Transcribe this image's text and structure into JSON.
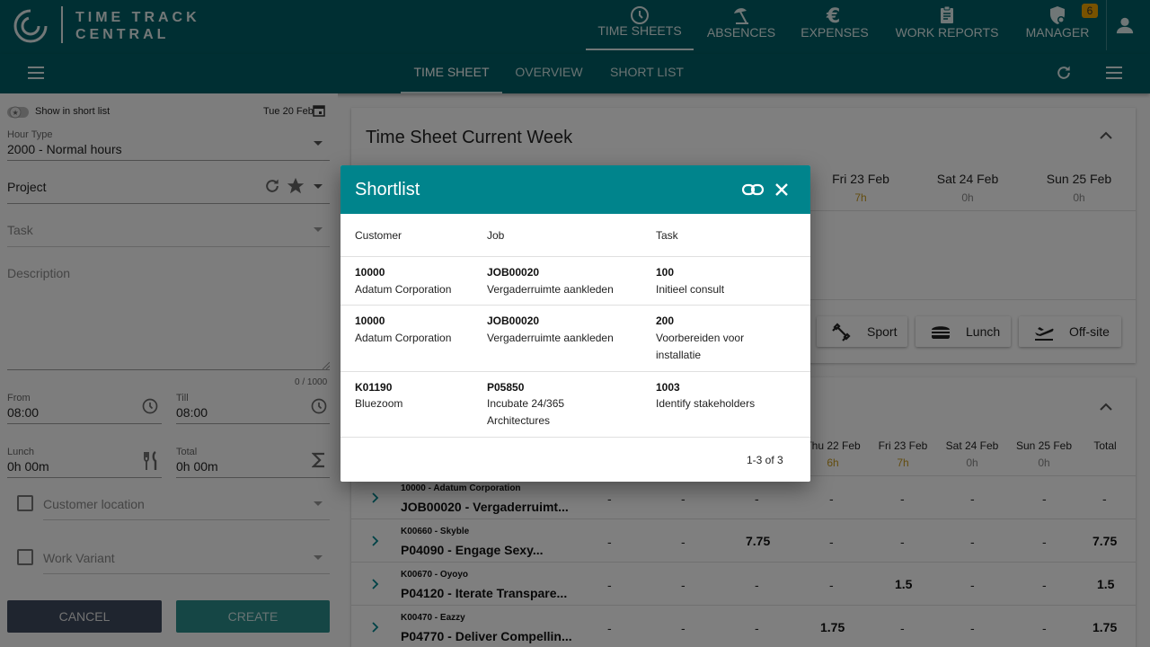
{
  "app": {
    "logo_line1": "TIME TRACK",
    "logo_line2": "CENTRAL",
    "nav": [
      {
        "label": "TIME SHEETS",
        "icon": "clock-icon"
      },
      {
        "label": "ABSENCES",
        "icon": "beach-umbrella-icon"
      },
      {
        "label": "EXPENSES",
        "icon": "euro-icon"
      },
      {
        "label": "WORK REPORTS",
        "icon": "clipboard-icon"
      },
      {
        "label": "MANAGER",
        "icon": "shield-user-icon"
      }
    ],
    "manager_badge": "6",
    "subtabs": [
      "TIME SHEET",
      "OVERVIEW",
      "SHORT LIST"
    ]
  },
  "form": {
    "show_in_short_list": "Show in short list",
    "date": "Tue 20 Feb",
    "hour_type_label": "Hour Type",
    "hour_type_value": "2000 - Normal hours",
    "project_placeholder": "Project",
    "task_placeholder": "Task",
    "description_placeholder": "Description",
    "description_counter": "0 / 1000",
    "from_label": "From",
    "from_value": "08:00",
    "till_label": "Till",
    "till_value": "08:00",
    "lunch_label": "Lunch",
    "lunch_value": "0h 00m",
    "total_label": "Total",
    "total_value": "0h 00m",
    "customer_location": "Customer location",
    "work_variant": "Work Variant",
    "cancel": "CANCEL",
    "create": "CREATE"
  },
  "week_card": {
    "title": "Time Sheet Current Week",
    "days": [
      {
        "label": "Fri 23 Feb",
        "value": "7h"
      },
      {
        "label": "Sat 24 Feb",
        "value": "0h"
      },
      {
        "label": "Sun 25 Feb",
        "value": "0h"
      }
    ],
    "chips": [
      "Sport",
      "Lunch",
      "Off-site"
    ]
  },
  "table_card": {
    "headers": [
      {
        "label": "Thu 22 Feb",
        "value": "6h"
      },
      {
        "label": "Fri 23 Feb",
        "value": "7h"
      },
      {
        "label": "Sat 24 Feb",
        "value": "0h"
      },
      {
        "label": "Sun 25 Feb",
        "value": "0h"
      }
    ],
    "total_header": "Total",
    "rows": [
      {
        "customer": "10000 - Adatum Corporation",
        "job": "JOB00020 - Vergaderruimt...",
        "cells": [
          "-",
          "-",
          "-",
          "-",
          "-",
          "-",
          "-",
          "-"
        ]
      },
      {
        "customer": "K00660 - Skyble",
        "job": "P04090 - Engage Sexy...",
        "cells": [
          "-",
          "-",
          "7.75",
          "-",
          "-",
          "-",
          "-",
          "7.75"
        ]
      },
      {
        "customer": "K00670 - Oyoyo",
        "job": "P04120 - Iterate Transpare...",
        "cells": [
          "-",
          "-",
          "-",
          "-",
          "1.5",
          "-",
          "-",
          "1.5"
        ]
      },
      {
        "customer": "K00470 - Eazzy",
        "job": "P04770 - Deliver Compellin...",
        "cells": [
          "-",
          "-",
          "-",
          "1.75",
          "-",
          "-",
          "-",
          "1.75"
        ]
      }
    ]
  },
  "shortlist": {
    "title": "Shortlist",
    "headers": {
      "customer": "Customer",
      "job": "Job",
      "task": "Task"
    },
    "rows": [
      {
        "customer_code": "10000",
        "customer_name": "Adatum Corporation",
        "job_code": "JOB00020",
        "job_name": "Vergaderruimte aankleden",
        "task_code": "100",
        "task_name": "Initieel consult"
      },
      {
        "customer_code": "10000",
        "customer_name": "Adatum Corporation",
        "job_code": "JOB00020",
        "job_name": "Vergaderruimte aankleden",
        "task_code": "200",
        "task_name": "Voorbereiden voor installatie"
      },
      {
        "customer_code": "K01190",
        "customer_name": "Bluezoom",
        "job_code": "P05850",
        "job_name": "Incubate 24/365 Architectures",
        "task_code": "1003",
        "task_name": "Identify stakeholders"
      }
    ],
    "pagination": "1-3 of 3"
  },
  "colors": {
    "header": "#005f66",
    "dialog_header": "#00848c",
    "accent": "#c79a1e"
  }
}
